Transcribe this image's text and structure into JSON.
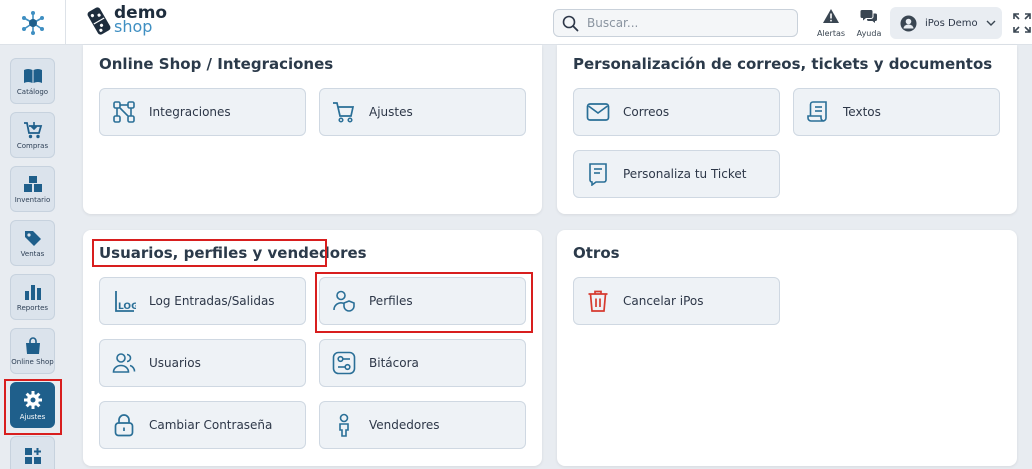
{
  "header": {
    "logo_demo": "demo",
    "logo_shop": "shop",
    "search_placeholder": "Buscar...",
    "alerts_label": "Alertas",
    "help_label": "Ayuda",
    "user_name": "iPos Demo"
  },
  "sidebar": {
    "items": [
      {
        "label": "Catálogo",
        "icon": "book-icon"
      },
      {
        "label": "Compras",
        "icon": "cart-icon"
      },
      {
        "label": "Inventario",
        "icon": "boxes-icon"
      },
      {
        "label": "Ventas",
        "icon": "tag-icon"
      },
      {
        "label": "Reportes",
        "icon": "bar-chart-icon"
      },
      {
        "label": "Online Shop",
        "icon": "shopping-bag-icon"
      },
      {
        "label": "Ajustes",
        "icon": "gear-icon"
      },
      {
        "label": "",
        "icon": "grid-plus-icon"
      }
    ]
  },
  "sections": {
    "online_shop": {
      "title": "Online Shop / Integraciones",
      "tiles": [
        {
          "label": "Integraciones",
          "icon": "integrations-icon"
        },
        {
          "label": "Ajustes",
          "icon": "cart-icon"
        }
      ]
    },
    "personalizacion": {
      "title": "Personalización de correos, tickets y documentos",
      "tiles": [
        {
          "label": "Correos",
          "icon": "mail-icon"
        },
        {
          "label": "Textos",
          "icon": "scroll-icon"
        },
        {
          "label": "Personaliza tu Ticket",
          "icon": "receipt-icon"
        }
      ]
    },
    "usuarios": {
      "title": "Usuarios, perfiles y vendedores",
      "tiles": [
        {
          "label": "Log Entradas/Salidas",
          "icon": "log-icon"
        },
        {
          "label": "Perfiles",
          "icon": "user-shield-icon"
        },
        {
          "label": "Usuarios",
          "icon": "users-icon"
        },
        {
          "label": "Bitácora",
          "icon": "sliders-icon"
        },
        {
          "label": "Cambiar Contraseña",
          "icon": "lock-icon"
        },
        {
          "label": "Vendedores",
          "icon": "person-icon"
        }
      ]
    },
    "otros": {
      "title": "Otros",
      "tiles": [
        {
          "label": "Cancelar iPos",
          "icon": "trash-icon"
        }
      ]
    }
  },
  "colors": {
    "accent": "#1f5f8b",
    "icon": "#2a6f97",
    "danger": "#d63a2f",
    "highlight": "#d81e1e"
  }
}
